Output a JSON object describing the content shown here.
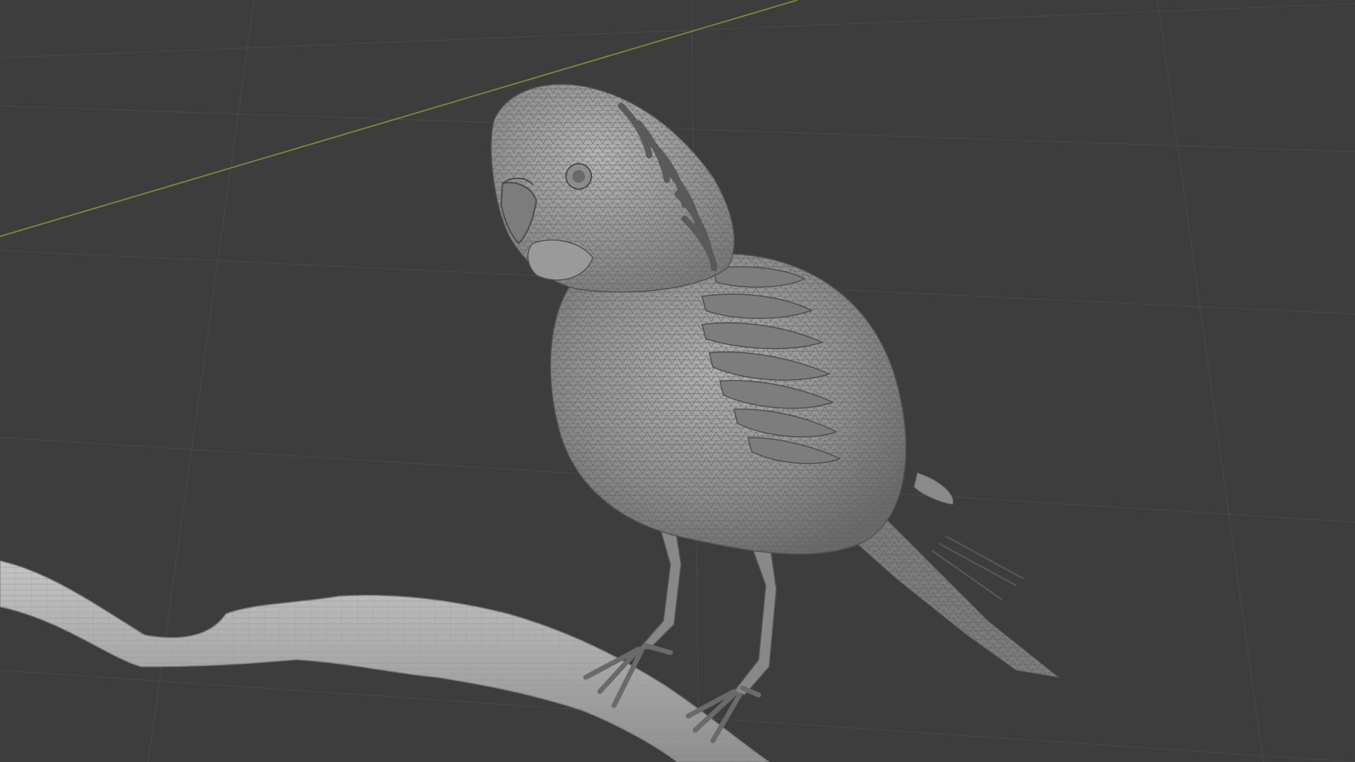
{
  "viewport": {
    "background": "#3d3d3d",
    "grid_color": "#4a4a4a",
    "x_axis_color": "#6e8a3a",
    "mesh_fill": "#8a8a8a",
    "mesh_wire": "#5a5a5a",
    "shadow_fill": "#6e6e6e"
  },
  "scene": {
    "subject": "budgerigar-mesh",
    "perch": "branch-mesh",
    "shading": "solid-with-wireframe"
  }
}
